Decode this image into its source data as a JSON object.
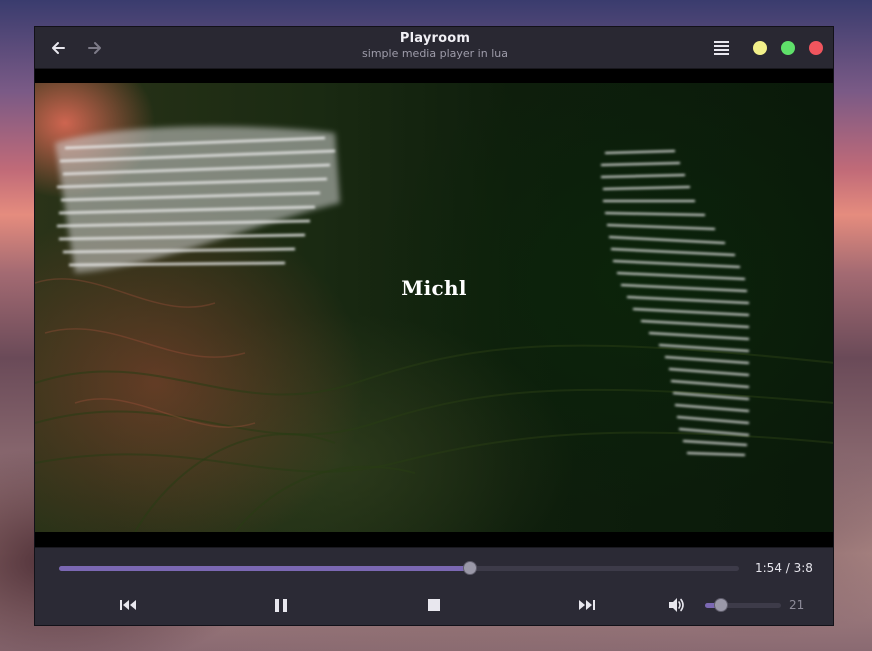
{
  "window": {
    "title": "Playroom",
    "subtitle": "simple media player in lua"
  },
  "header": {
    "back_icon": "arrow-left-icon",
    "forward_icon": "arrow-right-icon",
    "menu_icon": "hamburger-menu-icon",
    "window_buttons": [
      {
        "name": "minimize",
        "color": "#f2f08a"
      },
      {
        "name": "maximize",
        "color": "#5fe06a"
      },
      {
        "name": "close",
        "color": "#f0555e"
      }
    ]
  },
  "video": {
    "overlay_text": "Michl"
  },
  "playback": {
    "time": "1:54 / 3:8",
    "progress": 0.605,
    "accent_color": "#7b68b3"
  },
  "controls": {
    "previous_icon": "skip-back-icon",
    "pause_icon": "pause-icon",
    "stop_icon": "stop-icon",
    "next_icon": "skip-forward-icon",
    "volume_icon": "volume-icon"
  },
  "volume": {
    "value": "21",
    "level": 0.21
  }
}
